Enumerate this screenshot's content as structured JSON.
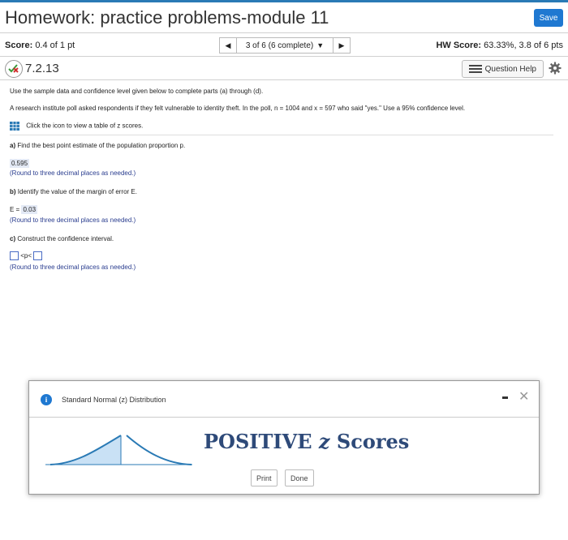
{
  "header": {
    "title": "Homework: practice problems-module 11",
    "save_label": "Save"
  },
  "score_bar": {
    "score_label": "Score:",
    "score_value": "0.4 of 1 pt",
    "nav_text": "3 of 6 (6 complete)",
    "hw_label": "HW Score:",
    "hw_value": "63.33%, 3.8 of 6 pts"
  },
  "question": {
    "number": "7.2.13",
    "help_label": "Question Help"
  },
  "problem": {
    "instructions": "Use the sample data and confidence level given below to complete parts (a) through (d).",
    "statement": "A research institute poll asked respondents if they felt vulnerable to identity theft. In the poll, n = 1004 and x = 597 who said \"yes.\" Use a 95% confidence level.",
    "table_link": "Click the icon to view a table of z scores.",
    "part_a_label": "a)",
    "part_a": "Find the best point estimate of the population proportion p.",
    "part_a_answer": "0.595",
    "part_a_hint": "(Round to three decimal places as needed.)",
    "part_b_label": "b)",
    "part_b": "Identify the value of the margin of error E.",
    "part_b_prefix": "E =",
    "part_b_answer": "0.03",
    "part_b_hint": "(Round to three decimal places as needed.)",
    "part_c_label": "c)",
    "part_c": "Construct the confidence interval.",
    "part_c_inequality": "<p<",
    "part_c_hint": "(Round to three decimal places as needed.)"
  },
  "dialog": {
    "title": "Standard Normal (z) Distribution",
    "heading_main": "POSITIVE ",
    "heading_z": "z",
    "heading_tail": " Scores",
    "print_label": "Print",
    "done_label": "Done"
  },
  "colors": {
    "accent": "#1f78d1",
    "hint_text": "#2a3d8f",
    "answer_bg": "#e3e9f5",
    "heading": "#2e4a79"
  }
}
